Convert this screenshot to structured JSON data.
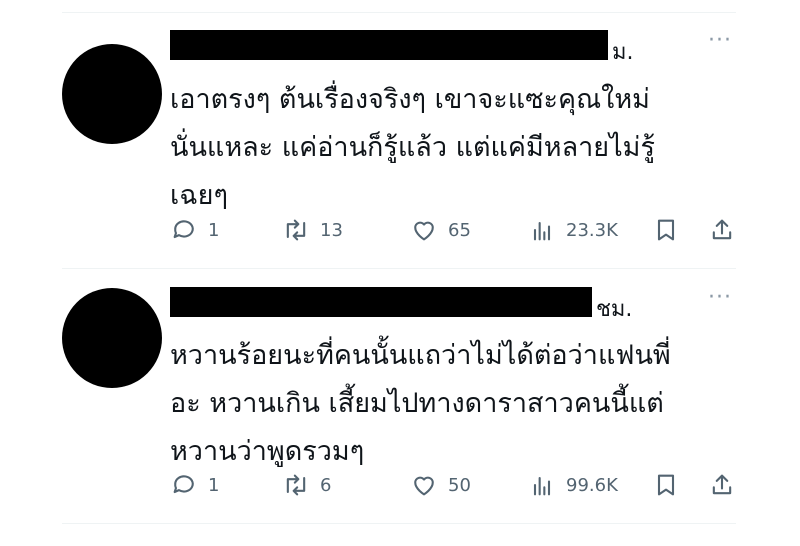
{
  "tweets": [
    {
      "suffix": "ม.",
      "more": "···",
      "text": "เอาตรงๆ ต้นเรื่องจริงๆ เขาจะแซะคุณใหม่\nนั่นแหละ แค่อ่านก็รู้แล้ว แต่แค่มีหลายไม่รู้\nเฉยๆ",
      "replies": "1",
      "reposts": "13",
      "likes": "65",
      "views": "23.3K"
    },
    {
      "suffix": "ชม.",
      "more": "···",
      "text": "หวานร้อยนะที่คนนั้นแถว่าไม่ได้ต่อว่าแฟนพี่\nอะ หวานเกิน เสี้ยมไปทางดาราสาวคนนี้แต่\nหวานว่าพูดรวมๆ",
      "replies": "1",
      "reposts": "6",
      "likes": "50",
      "views": "99.6K"
    }
  ],
  "icons": {
    "reply": "reply-icon",
    "repost": "repost-icon",
    "like": "heart-icon",
    "views": "analytics-icon",
    "bookmark": "bookmark-icon",
    "share": "share-icon"
  },
  "colors": {
    "text": "#0f1419",
    "muted": "#536471",
    "divider": "#eff3f4",
    "redaction": "#000000"
  }
}
